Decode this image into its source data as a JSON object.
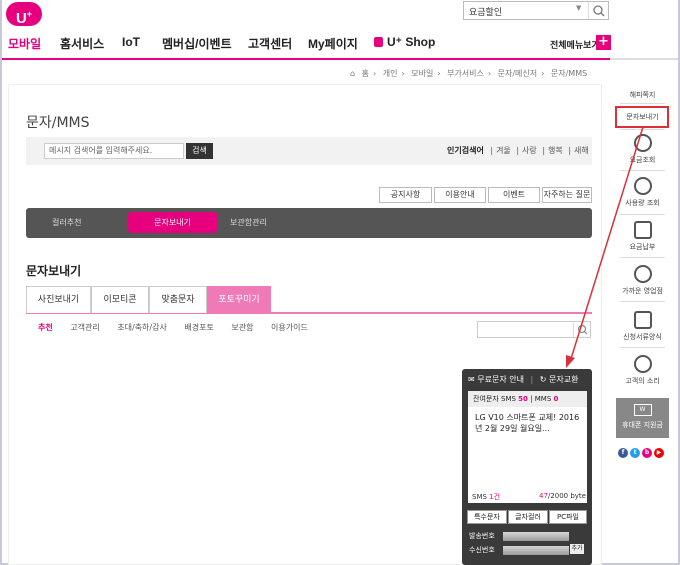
{
  "brand": {
    "logo_text": "U",
    "logo_sup": "+"
  },
  "search": {
    "value": "요금할인"
  },
  "gnb": {
    "items": [
      "모바일",
      "홈서비스",
      "IoT",
      "멤버십/이벤트",
      "고객센터",
      "My페이지"
    ],
    "shop_label": "U⁺ Shop",
    "full_menu": "전체메뉴보기",
    "plus": "+"
  },
  "breadcrumb": [
    "홈",
    "개인",
    "모바일",
    "부가서비스",
    "문자/메신저",
    "문자/MMS"
  ],
  "page": {
    "title": "문자/MMS",
    "msg_search_placeholder": "메시지 검색어를 입력해주세요.",
    "msg_search_button": "검색",
    "popular_label": "인기검색어",
    "popular_terms": [
      "겨울",
      "사랑",
      "행복",
      "새해"
    ]
  },
  "quick_buttons": [
    "공지사항",
    "이용안내",
    "이벤트",
    "자주하는 질문"
  ],
  "dark_tabs": [
    "컬러추천",
    "문자보내기",
    "보관함관리"
  ],
  "section_title": "문자보내기",
  "tabs": [
    "사진보내기",
    "이모티콘",
    "맞춤문자",
    "포토꾸미기"
  ],
  "sub_menu": [
    "추천",
    "고객관리",
    "초대/축하/감사",
    "배경포토",
    "보관함",
    "이용가이드"
  ],
  "phone": {
    "free_guide": "무료문자 안내",
    "exchange": "문자교환",
    "remain_label": "잔여문자",
    "sms_label": "SMS",
    "sms_count": "50",
    "mms_label": "MMS",
    "mms_count": "0",
    "message": "LG V10 스마트폰 교체! 2016년 2월 29일 월요일...",
    "count_label": "SMS",
    "count_value": "1건",
    "bytes_value": "47",
    "bytes_total": "/2000 byte",
    "buttons": [
      "특수문자",
      "글자컬러",
      "PC파일"
    ],
    "sender_label": "발송번호",
    "receiver_label": "수신번호",
    "add_label": "추가"
  },
  "right_bar": {
    "items": [
      "해피쪽지",
      "문자보내기",
      "요금조회",
      "사용량 조회",
      "요금납부",
      "가까운 영업점",
      "신청서류양식",
      "고객의 소리",
      "휴대폰 지원금"
    ],
    "wbox": "W"
  },
  "colors": {
    "accent": "#e6007e",
    "highlight": "#d9303a"
  }
}
